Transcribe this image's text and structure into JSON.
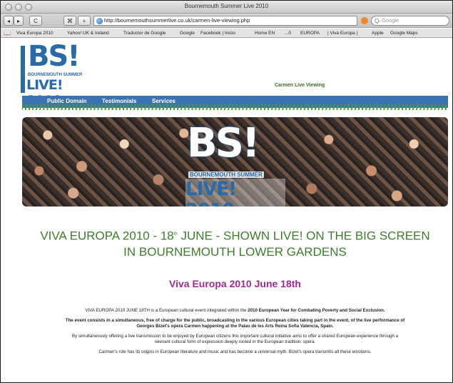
{
  "window": {
    "title": "Bournemouth Summer Live 2010"
  },
  "toolbar": {
    "back": "◂",
    "forward": "▸",
    "reload": "C",
    "reader": "⌘",
    "add": "+",
    "url": "http://bournemouthsummerlive.co.uk/carmen-live-viewing.php",
    "search_placeholder": "Google",
    "search_prefix": "Q-"
  },
  "bookmarks": [
    "Viva Europa 2010",
    "Yahoo! UK & Ireland",
    "Traductor de Google",
    "Google",
    "Facebook | Inicio",
    "Home EN",
    "...0",
    "EUROPA",
    "| Viva Europa |",
    "Apple",
    "Google Maps"
  ],
  "logo": {
    "bs": "BS!",
    "sub": "BOURNEMOUTH SUMMER",
    "live": "LIVE! 2010"
  },
  "page_tagline": "Carmen Live Viewing",
  "nav": [
    "Public Domain",
    "Testimonials",
    "Services"
  ],
  "banner": {
    "bs": "BS!",
    "sub": "BOURNEMOUTH SUMMER",
    "live": "LIVE! 2010"
  },
  "headline": {
    "part1": "VIVA EUROPA 2010 - 18",
    "sup": "th",
    "part2": " JUNE - SHOWN LIVE! ON THE BIG SCREEN IN BOURNEMOUTH LOWER GARDENS"
  },
  "subhead": "Viva Europa 2010 June 18th",
  "body": {
    "p1_start": "VIVA EUROPA 2010 JUNE 18TH is a European cultural event integrated within the ",
    "p1_bold": "2010 European Year for Combating Poverty and Social Exclusion.",
    "p2": "The event consists in a simultaneous, free of charge for the public, broadcasting in the various European cities taking part in the event, of the live performance of Georges Bizet's opera Carmen happening at the Palau de les Arts Reina Sofia Valencia, Spain.",
    "p3": "By simultaneously offering a live transmission to be enjoyed by European citizens this important cultural initiative aims to offer a shared European experience through a relevant cultural form of expression deeply rooted in the European tradition: opera.",
    "p4": "Carmen's role has its origins in European literature and music and has become a universal myth. Bizet's opera transmits all these emotions."
  },
  "colors": {
    "brand_blue": "#2a6aa8",
    "nav_blue": "#3a73b0",
    "headline_green": "#3e7d2c",
    "subhead_purple": "#9c2a8f"
  }
}
